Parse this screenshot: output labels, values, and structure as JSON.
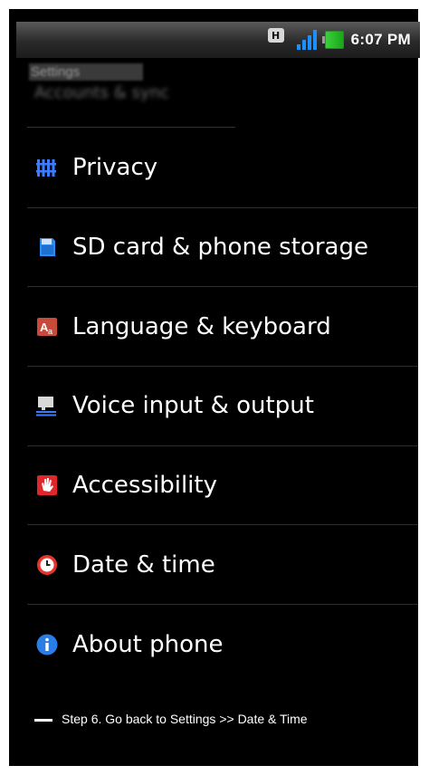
{
  "status_bar": {
    "network_badge": "H",
    "time": "6:07 PM",
    "colors": {
      "signal": "#1e8fff",
      "battery": "#2fbf2f"
    }
  },
  "header": {
    "title": "Settings",
    "partial_item": "Accounts & sync"
  },
  "settings": {
    "items": [
      {
        "label": "Privacy",
        "icon": "privacy-icon"
      },
      {
        "label": "SD card & phone storage",
        "icon": "sd-card-icon"
      },
      {
        "label": "Language & keyboard",
        "icon": "language-icon"
      },
      {
        "label": "Voice input & output",
        "icon": "voice-icon"
      },
      {
        "label": "Accessibility",
        "icon": "accessibility-icon"
      },
      {
        "label": "Date & time",
        "icon": "clock-icon"
      },
      {
        "label": "About phone",
        "icon": "info-icon"
      }
    ]
  },
  "caption": {
    "text": "Step 6. Go back to Settings >> Date & Time"
  }
}
